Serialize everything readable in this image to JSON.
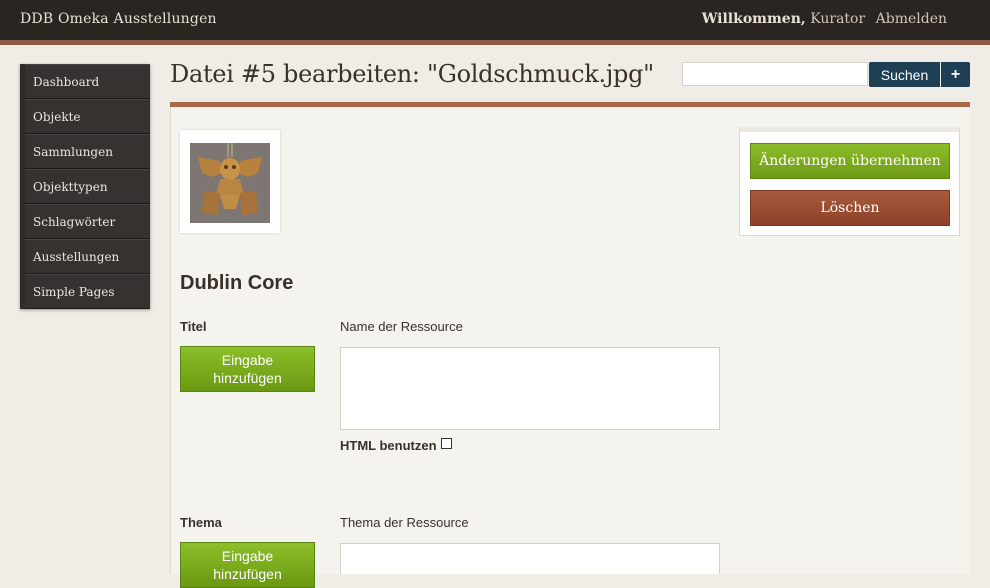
{
  "topbar": {
    "site_title": "DDB Omeka Ausstellungen",
    "welcome_label": "Willkommen,",
    "user_name": "Kurator",
    "logout_label": "Abmelden"
  },
  "nav": {
    "items": [
      {
        "label": "Dashboard"
      },
      {
        "label": "Objekte"
      },
      {
        "label": "Sammlungen"
      },
      {
        "label": "Objekttypen"
      },
      {
        "label": "Schlagwörter"
      },
      {
        "label": "Ausstellungen"
      },
      {
        "label": "Simple Pages"
      }
    ]
  },
  "header": {
    "title": "Datei #5 bearbeiten: \"Goldschmuck.jpg\""
  },
  "search": {
    "value": "",
    "button_label": "Suchen",
    "advanced_label": "+"
  },
  "actions": {
    "save_label": "Änderungen übernehmen",
    "delete_label": "Löschen"
  },
  "form": {
    "section_title": "Dublin Core",
    "fields": [
      {
        "label": "Titel",
        "description": "Name der Ressource",
        "add_label": "Eingabe hinzufügen",
        "value": "",
        "html_label": "HTML benutzen"
      },
      {
        "label": "Thema",
        "description": "Thema der Ressource",
        "add_label": "Eingabe hinzufügen",
        "value": ""
      }
    ]
  },
  "colors": {
    "topbar_bg": "#2b2522",
    "accent_rule": "#a9674b",
    "save_green": "#7aa81e",
    "delete_brown": "#9a4e33",
    "search_navy": "#1f3f55"
  }
}
